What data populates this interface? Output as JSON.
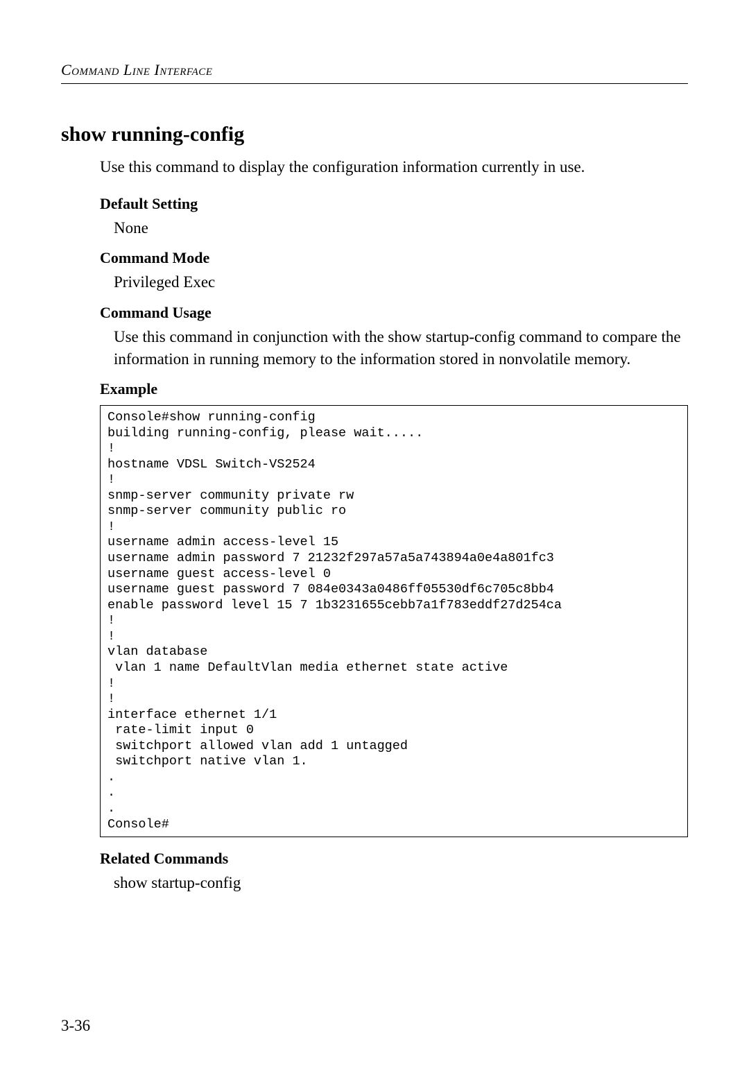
{
  "header": {
    "running": "Command Line Interface"
  },
  "title": "show running-config",
  "intro": "Use this command to display the configuration information currently in use.",
  "sections": {
    "defaultSetting": {
      "label": "Default Setting",
      "body": "None"
    },
    "commandMode": {
      "label": "Command Mode",
      "body": "Privileged Exec"
    },
    "commandUsage": {
      "label": "Command Usage",
      "body": "Use this command in conjunction with the show startup-config command to compare the information in running memory to the information stored in nonvolatile memory."
    },
    "example": {
      "label": "Example",
      "code": "Console#show running-config\nbuilding running-config, please wait.....\n!\nhostname VDSL Switch-VS2524\n!\nsnmp-server community private rw\nsnmp-server community public ro\n!\nusername admin access-level 15\nusername admin password 7 21232f297a57a5a743894a0e4a801fc3\nusername guest access-level 0\nusername guest password 7 084e0343a0486ff05530df6c705c8bb4\nenable password level 15 7 1b3231655cebb7a1f783eddf27d254ca\n!\n!\nvlan database\n vlan 1 name DefaultVlan media ethernet state active\n!\n!\ninterface ethernet 1/1\n rate-limit input 0\n switchport allowed vlan add 1 untagged\n switchport native vlan 1.\n.\n.\n.\nConsole#"
    },
    "relatedCommands": {
      "label": "Related Commands",
      "body": "show startup-config"
    }
  },
  "pageNumber": "3-36"
}
